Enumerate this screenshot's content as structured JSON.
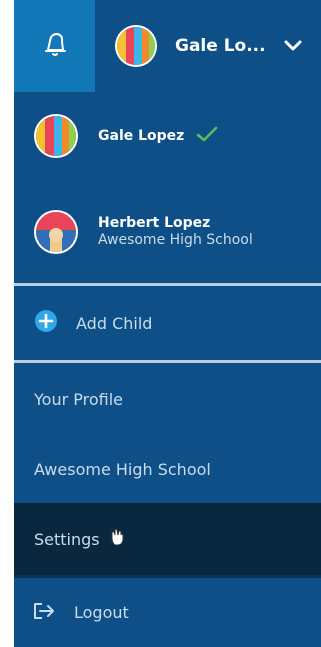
{
  "header": {
    "current_user_short": "Gale Lo...",
    "bell_icon": "bell-icon",
    "dropdown_icon": "chevron-down-icon"
  },
  "users": [
    {
      "name": "Gale Lopez",
      "subtitle": "",
      "selected": true,
      "avatar_icon": "striped-avatar"
    },
    {
      "name": "Herbert Lopez",
      "subtitle": "Awesome High School",
      "selected": false,
      "avatar_icon": "red-blue-avatar"
    }
  ],
  "menu": {
    "add_child": "Add Child",
    "your_profile": "Your Profile",
    "school": "Awesome High School",
    "settings": "Settings",
    "logout": "Logout"
  },
  "colors": {
    "panel": "#0d4f86",
    "bell_bg": "#1378b8",
    "active_row": "#0a2740",
    "separator": "#b9cfe3",
    "check": "#5cc05a",
    "add_icon": "#2ea8ea"
  }
}
